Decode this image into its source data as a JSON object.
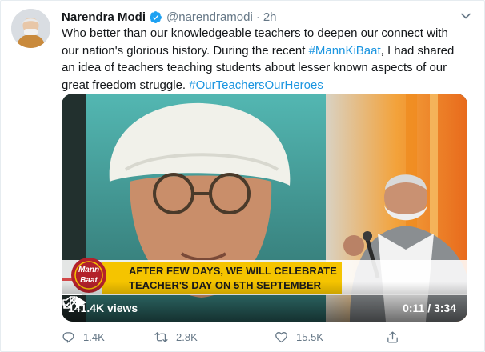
{
  "author": {
    "name": "Narendra Modi",
    "handle": "@narendramodi",
    "separator": "·",
    "time": "2h"
  },
  "tweet": {
    "text_1": "Who better than our knowledgeable teachers to deepen our connect with our nation's glorious history. During the recent ",
    "hashtag_1": "#MannKiBaat",
    "text_2": ", I had shared an idea of teachers teaching students about lesser known aspects of our great freedom struggle. ",
    "hashtag_2": "#OurTeachersOurHeroes"
  },
  "video": {
    "banner_logo_line1": "Mann",
    "banner_logo_line2": "Baat",
    "banner_line1": "AFTER FEW DAYS, WE WILL CELEBRATE",
    "banner_line2": "TEACHER'S DAY ON 5TH SEPTEMBER",
    "views": "141.4K views",
    "timecode": "0:11 / 3:34",
    "progress": 0.051
  },
  "actions": {
    "replies": "1.4K",
    "retweets": "2.8K",
    "likes": "15.5K"
  },
  "colors": {
    "link": "#1b95e0",
    "verified": "#1da1f2",
    "banner_yellow": "#f5c400"
  }
}
